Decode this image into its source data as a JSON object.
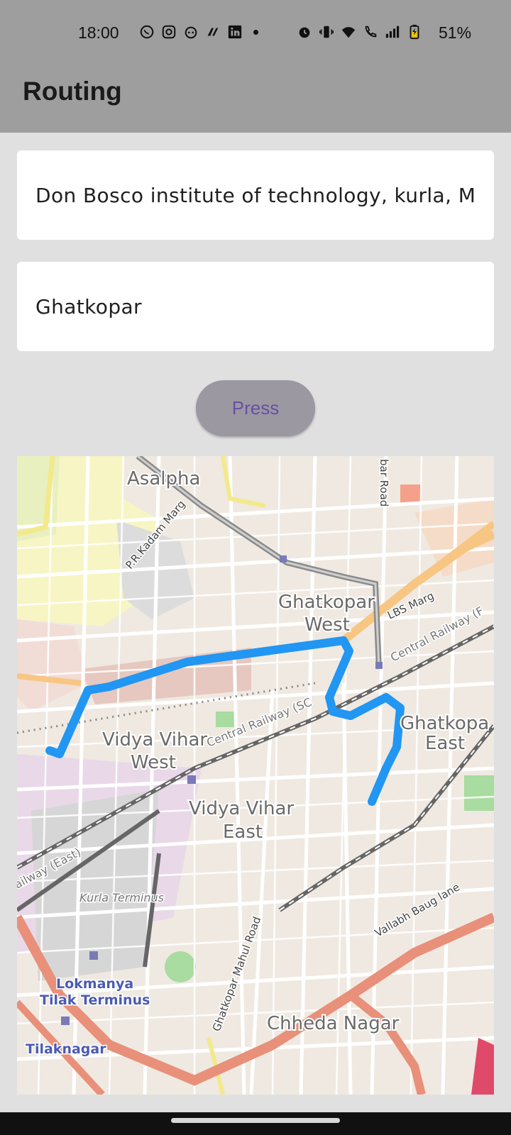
{
  "status_bar": {
    "time": "18:00",
    "battery": "51%",
    "left_icons": [
      "whatsapp-icon",
      "instagram-icon",
      "reddit-icon",
      "app-icon",
      "linkedin-icon"
    ],
    "right_icons": [
      "alarm-icon",
      "vibrate-icon",
      "wifi-icon",
      "wifi-calling-icon",
      "signal-icon",
      "battery-charging-icon"
    ]
  },
  "app_bar": {
    "title": "Routing"
  },
  "form": {
    "from_value": "Don Bosco institute of technology, kurla, Mumbai",
    "to_value": "Ghatkopar",
    "button_label": "Press"
  },
  "map": {
    "labels": {
      "asalpha": "Asalpha",
      "pr_kadam": "P.R.Kadam Marg",
      "ghatkopar_west_1": "Ghatkopar",
      "ghatkopar_west_2": "West",
      "lbs_marg": "LBS Marg",
      "central_railway_ne": "Central Railway (F",
      "ghatkopar_east_1": "Ghatkopa",
      "ghatkopar_east_2": "East",
      "vidya_vihar_west_1": "Vidya Vihar",
      "vidya_vihar_west_2": "West",
      "vidya_vihar_east_1": "Vidya Vihar",
      "vidya_vihar_east_2": "East",
      "central_railway_mid": "Central Railway (SC",
      "kurla_terminus": "Kurla Terminus",
      "railway_east": "ailway (East)",
      "ltt_1": "Lokmanya",
      "ltt_2": "Tilak Terminus",
      "tilaknagar": "Tilaknagar",
      "mahul_road": "Ghatkopar Mahul Road",
      "vallabh_baug": "Vallabh Baug lane",
      "chheda_nagar": "Chheda Nagar",
      "bar_road": "bar Road"
    },
    "route_color": "#2196f3"
  },
  "colors": {
    "background": "#e0e0e0",
    "app_bar": "#9e9e9e",
    "button_bg": "#9b98a2",
    "button_text": "#6750a4"
  }
}
